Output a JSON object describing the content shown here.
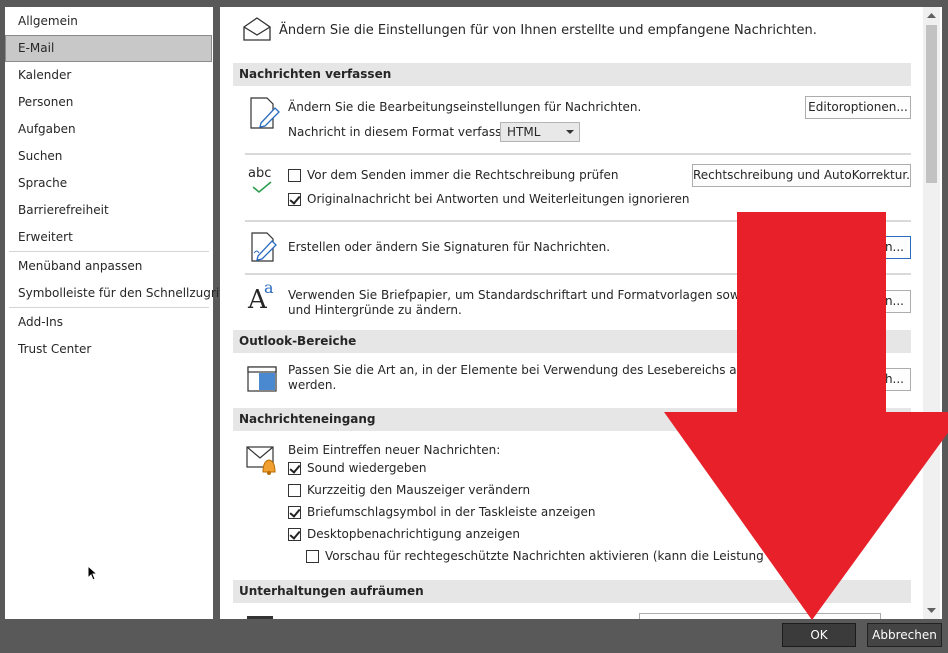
{
  "sidebar": {
    "items": [
      {
        "label": "Allgemein"
      },
      {
        "label": "E-Mail"
      },
      {
        "label": "Kalender"
      },
      {
        "label": "Personen"
      },
      {
        "label": "Aufgaben"
      },
      {
        "label": "Suchen"
      },
      {
        "label": "Sprache"
      },
      {
        "label": "Barrierefreiheit"
      },
      {
        "label": "Erweitert"
      },
      {
        "label": "Menüband anpassen"
      },
      {
        "label": "Symbolleiste für den Schnellzugriff"
      },
      {
        "label": "Add-Ins"
      },
      {
        "label": "Trust Center"
      }
    ],
    "selected": "E-Mail"
  },
  "main": {
    "header_text": "Ändern Sie die Einstellungen für von Ihnen erstellte und empfangene Nachrichten.",
    "compose": {
      "heading": "Nachrichten verfassen",
      "editor_text": "Ändern Sie die Bearbeitungseinstellungen für Nachrichten.",
      "editor_button": "Editoroptionen...",
      "format_label": "Nachricht in diesem Format verfassen:",
      "format_value": "HTML",
      "spell_icon_text": "abc",
      "spell_check_label": "Vor dem Senden immer die Rechtschreibung prüfen",
      "spell_check_checked": false,
      "ignore_original_label": "Originalnachricht bei Antworten und Weiterleitungen ignorieren",
      "ignore_original_checked": true,
      "spell_button": "Rechtschreibung und AutoKorrektur...",
      "signature_text": "Erstellen oder ändern Sie Signaturen für Nachrichten.",
      "signature_button": "n...",
      "stationery_line1": "Verwenden Sie Briefpapier, um Standardschriftart und Formatvorlagen sowie Farben",
      "stationery_line2": "und Hintergründe zu ändern.",
      "stationery_button": "n..."
    },
    "panes": {
      "heading": "Outlook-Bereiche",
      "reading_line1": "Passen Sie die Art an, in der Elemente bei Verwendung des Lesebereichs als gelesen m",
      "reading_line2": "werden.",
      "reading_button": "h..."
    },
    "arrival": {
      "heading": "Nachrichteneingang",
      "intro": "Beim Eintreffen neuer Nachrichten:",
      "options": [
        {
          "label": "Sound wiedergeben",
          "checked": true
        },
        {
          "label": "Kurzzeitig den Mauszeiger verändern",
          "checked": false
        },
        {
          "label": "Briefumschlagsymbol in der Taskleiste anzeigen",
          "checked": true
        },
        {
          "label": "Desktopbenachrichtigung anzeigen",
          "checked": true
        },
        {
          "label": "Vorschau für rechtegeschützte Nachrichten aktivieren (kann die Leistung verschlech",
          "checked": false
        }
      ]
    },
    "cleanup": {
      "heading": "Unterhaltungen aufräumen"
    }
  },
  "footer": {
    "ok_label": "OK",
    "cancel_label": "Abbrechen"
  },
  "colors": {
    "arrow": "#e8202a",
    "selection": "#c8c8c8",
    "section_bg": "#e6e6e6",
    "window_bg": "#595959"
  }
}
